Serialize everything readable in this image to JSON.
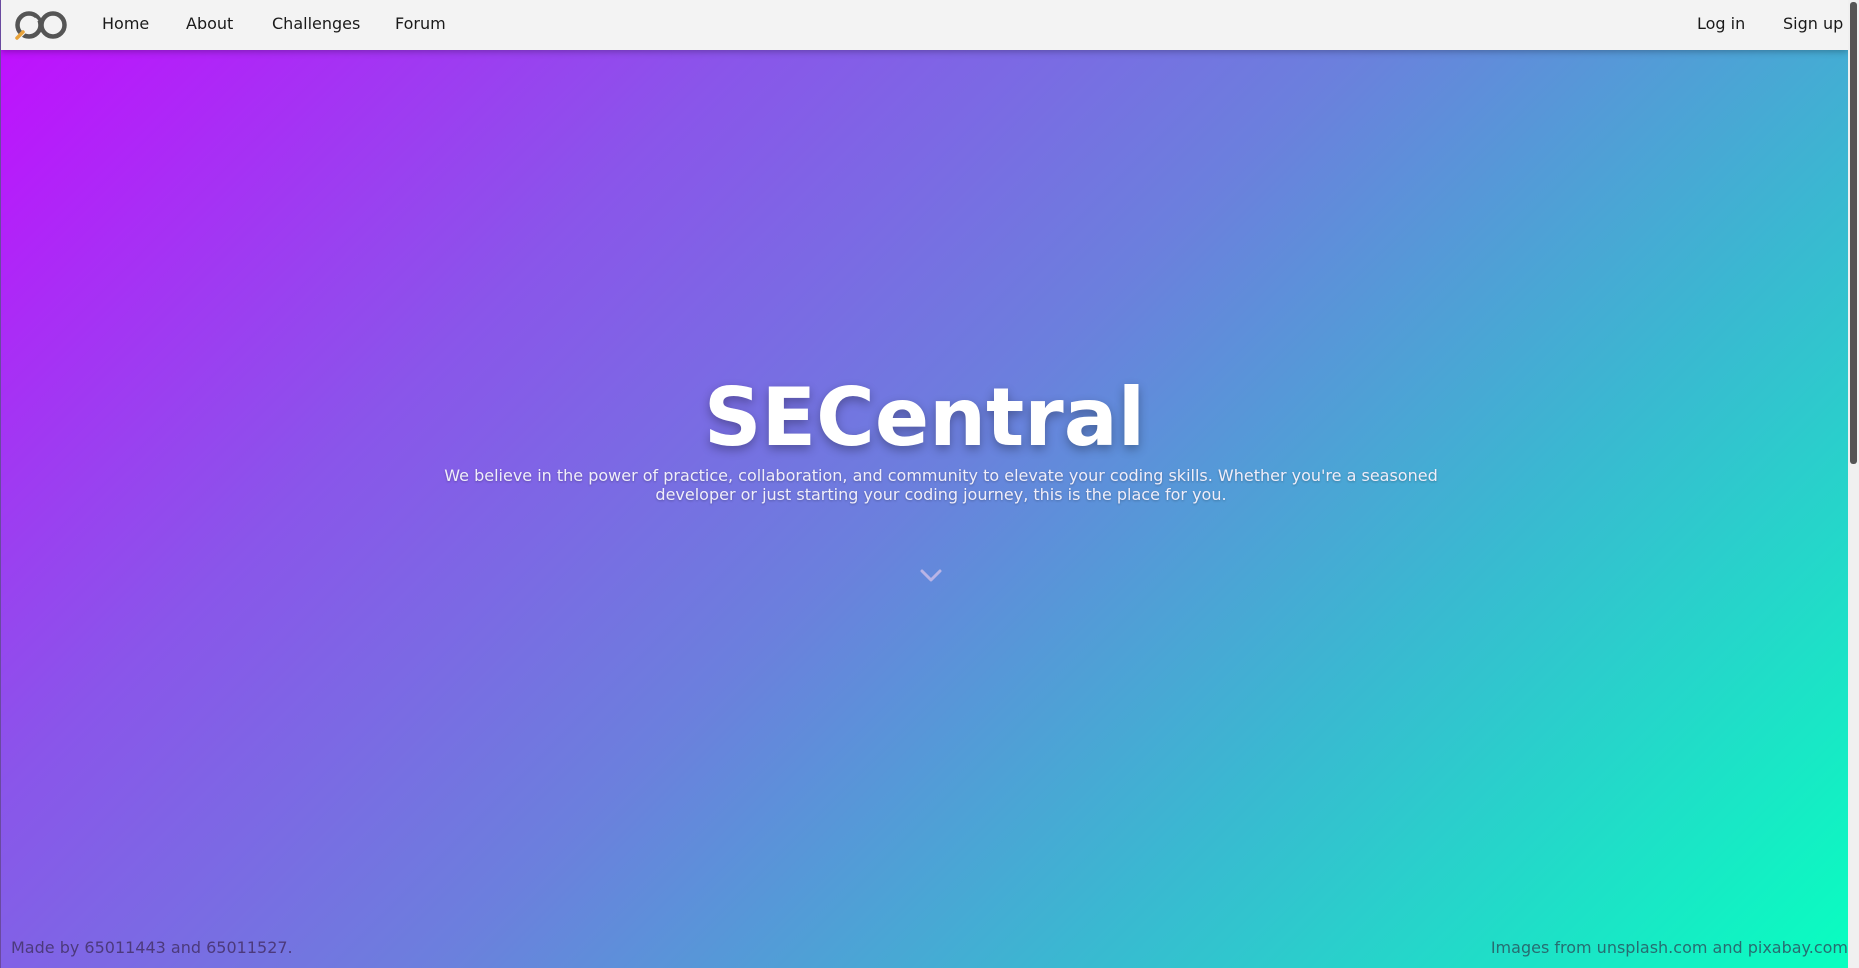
{
  "navbar": {
    "logo_icon": "infinity-logo-icon",
    "links": [
      {
        "label": "Home"
      },
      {
        "label": "About"
      },
      {
        "label": "Challenges"
      },
      {
        "label": "Forum"
      }
    ],
    "login_label": "Log in",
    "signup_label": "Sign up"
  },
  "hero": {
    "title": "SECentral",
    "subtitle": "We believe in the power of practice, collaboration, and community to elevate your coding skills. Whether you're a seasoned developer or just starting your coding journey, this is the place for you.",
    "scroll_icon": "chevron-down-icon",
    "gradient_colors": [
      "#c30cff",
      "#8a55ea",
      "#6b80dd",
      "#3ab8d1",
      "#08ffc0"
    ]
  },
  "footer": {
    "left_text": "Made by 65011443 and 65011527.",
    "right_text": "Images from unsplash.com and pixabay.com"
  }
}
